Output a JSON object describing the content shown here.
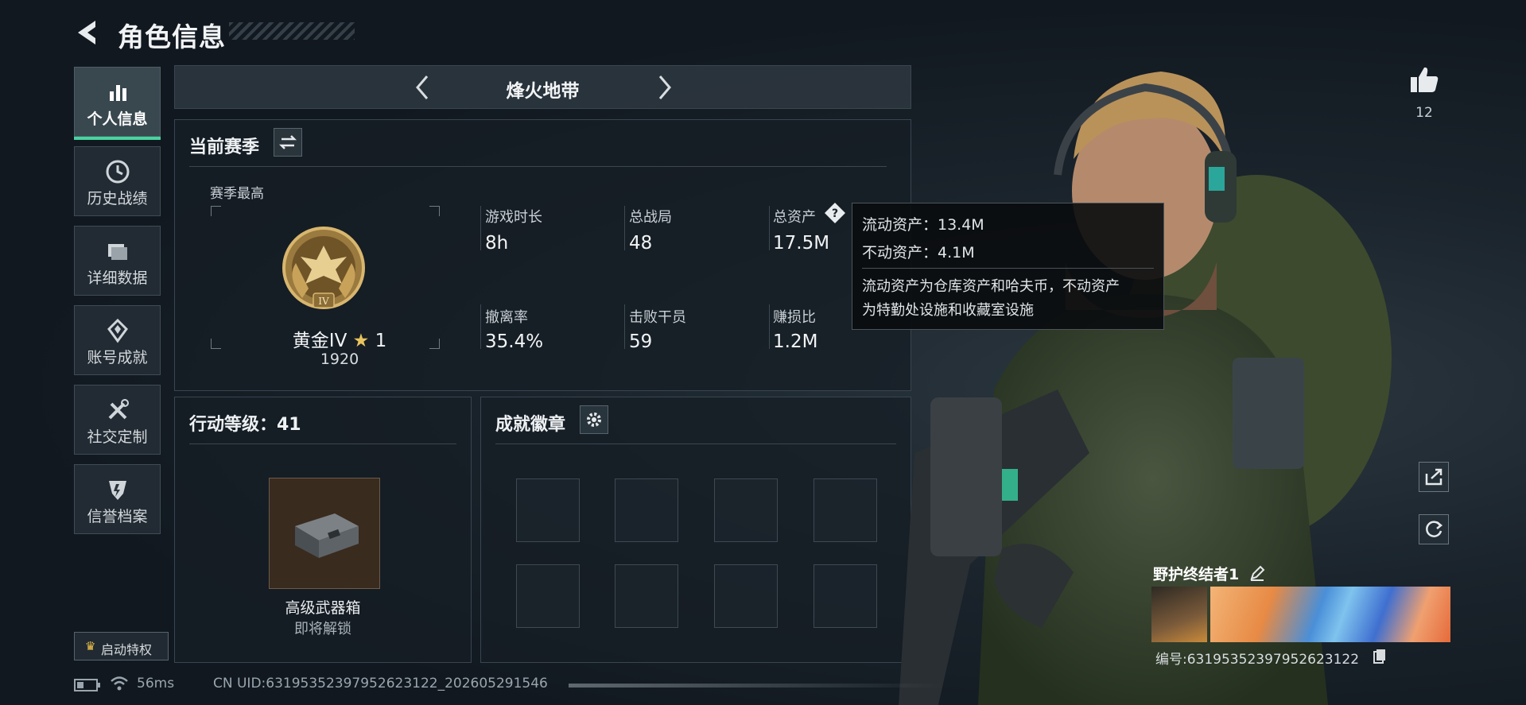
{
  "header": {
    "title": "角色信息"
  },
  "sidebar": {
    "items": [
      {
        "label": "个人信息",
        "icon": "bar-chart-icon"
      },
      {
        "label": "历史战绩",
        "icon": "clock-icon"
      },
      {
        "label": "详细数据",
        "icon": "folder-icon"
      },
      {
        "label": "账号成就",
        "icon": "medal-icon"
      },
      {
        "label": "社交定制",
        "icon": "tools-icon"
      },
      {
        "label": "信誉档案",
        "icon": "shield-icon"
      }
    ],
    "privilege_label": "启动特权"
  },
  "mode_selector": {
    "label": "烽火地带"
  },
  "season": {
    "title": "当前赛季",
    "best_label": "赛季最高",
    "rank_name": "黄金IV",
    "rank_stars": "1",
    "rank_numeral": "IV",
    "rank_score": "1920",
    "stats": [
      {
        "label": "游戏时长",
        "value": "8h"
      },
      {
        "label": "总战局",
        "value": "48"
      },
      {
        "label": "总资产",
        "value": "17.5M"
      },
      {
        "label": "撤离率",
        "value": "35.4%"
      },
      {
        "label": "击败干员",
        "value": "59"
      },
      {
        "label": "赚损比",
        "value": "1.2M"
      }
    ]
  },
  "tooltip": {
    "line1": "流动资产：13.4M",
    "line2": "不动资产：4.1M",
    "desc1": "流动资产为仓库资产和哈夫币，不动资产",
    "desc2": "为特勤处设施和收藏室设施"
  },
  "action_level": {
    "title": "行动等级：41",
    "reward_name": "高级武器箱",
    "reward_status": "即将解锁"
  },
  "achievements": {
    "title": "成就徽章"
  },
  "profile": {
    "likes": "12",
    "nickname": "野护终结者1",
    "id_line": "编号:6319535239795262312​2"
  },
  "footer": {
    "ping": "56ms",
    "uid": "CN UID:6319535239795262312​2_202605291546"
  },
  "colors": {
    "accent": "#48d3a0",
    "panel_border": "#384550"
  }
}
